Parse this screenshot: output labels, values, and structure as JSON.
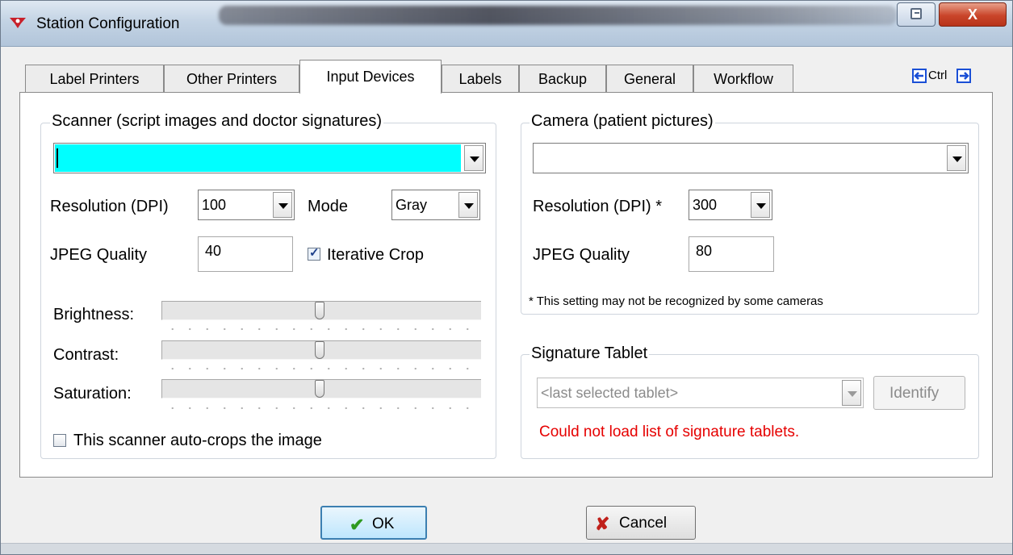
{
  "window": {
    "title": "Station Configuration",
    "close_label": "X"
  },
  "tabs": [
    {
      "label": "Label Printers",
      "active": false
    },
    {
      "label": "Other Printers",
      "active": false
    },
    {
      "label": "Input Devices",
      "active": true
    },
    {
      "label": "Labels",
      "active": false
    },
    {
      "label": "Backup",
      "active": false
    },
    {
      "label": "General",
      "active": false
    },
    {
      "label": "Workflow",
      "active": false
    }
  ],
  "tab_nav": {
    "label": "Ctrl"
  },
  "scanner": {
    "group_label": "Scanner (script images and doctor signatures)",
    "device_value": "",
    "device_highlight_color": "#00ffff",
    "resolution_label": "Resolution (DPI)",
    "resolution_value": "100",
    "mode_label": "Mode",
    "mode_value": "Gray",
    "jpeg_label": "JPEG Quality",
    "jpeg_value": "40",
    "iterative_crop_label": "Iterative Crop",
    "iterative_crop_checked": true,
    "brightness_label": "Brightness:",
    "contrast_label": "Contrast:",
    "saturation_label": "Saturation:",
    "brightness_level": 0.5,
    "contrast_level": 0.5,
    "saturation_level": 0.5,
    "autocrop_label": "This scanner auto-crops the image",
    "autocrop_checked": false
  },
  "camera": {
    "group_label": "Camera (patient pictures)",
    "device_value": "",
    "resolution_label": "Resolution (DPI) *",
    "resolution_value": "300",
    "jpeg_label": "JPEG Quality",
    "jpeg_value": "80",
    "note": "* This setting may not be recognized by some cameras"
  },
  "signature_tablet": {
    "group_label": "Signature Tablet",
    "tablet_value": "<last selected tablet>",
    "identify_label": "Identify",
    "error_text": "Could not load list of signature tablets.",
    "error_color": "#e60000"
  },
  "footer": {
    "ok_label": "OK",
    "cancel_label": "Cancel"
  }
}
